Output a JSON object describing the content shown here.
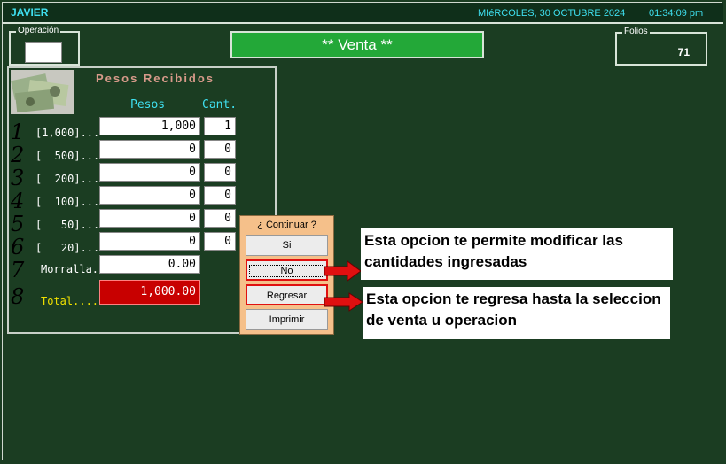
{
  "header": {
    "user": "JAVIER",
    "date": "MIéRCOLES, 30  OCTUBRE 2024",
    "time": "01:34:09 pm"
  },
  "operacion": {
    "legend": "Operación",
    "value": ""
  },
  "banner": {
    "title": "** Venta **"
  },
  "folios": {
    "legend": "Folios",
    "value": "71"
  },
  "pesos_panel": {
    "title": "Pesos Recibidos",
    "col_pesos": "Pesos",
    "col_cant": "Cant.",
    "rows": [
      {
        "key": "1",
        "label": "[1,000]...",
        "pesos": "1,000",
        "cant": "1"
      },
      {
        "key": "2",
        "label": "[  500]...",
        "pesos": "0",
        "cant": "0"
      },
      {
        "key": "3",
        "label": "[  200]...",
        "pesos": "0",
        "cant": "0"
      },
      {
        "key": "4",
        "label": "[  100]...",
        "pesos": "0",
        "cant": "0"
      },
      {
        "key": "5",
        "label": "[   50]...",
        "pesos": "0",
        "cant": "0"
      },
      {
        "key": "6",
        "label": "[   20]...",
        "pesos": "0",
        "cant": "0"
      }
    ],
    "morralla": {
      "key": "7",
      "label": "Morralla.",
      "value": "0.00"
    },
    "total": {
      "key": "8",
      "label": "Total....",
      "value": "1,000.00"
    }
  },
  "dialog": {
    "question": "¿ Continuar ?",
    "si": "Si",
    "no": "No",
    "regresar": "Regresar",
    "imprimir": "Imprimir"
  },
  "callouts": {
    "no_text": "Esta opcion te permite modificar las cantidades ingresadas",
    "regresar_text": "Esta opcion te regresa hasta la seleccion de venta u operacion"
  },
  "colors": {
    "background": "#1b3d22",
    "banner": "#23a838",
    "total": "#c80000",
    "accent": "#3fe0f0",
    "dialog": "#f5c08a",
    "arrow": "#e01010"
  }
}
